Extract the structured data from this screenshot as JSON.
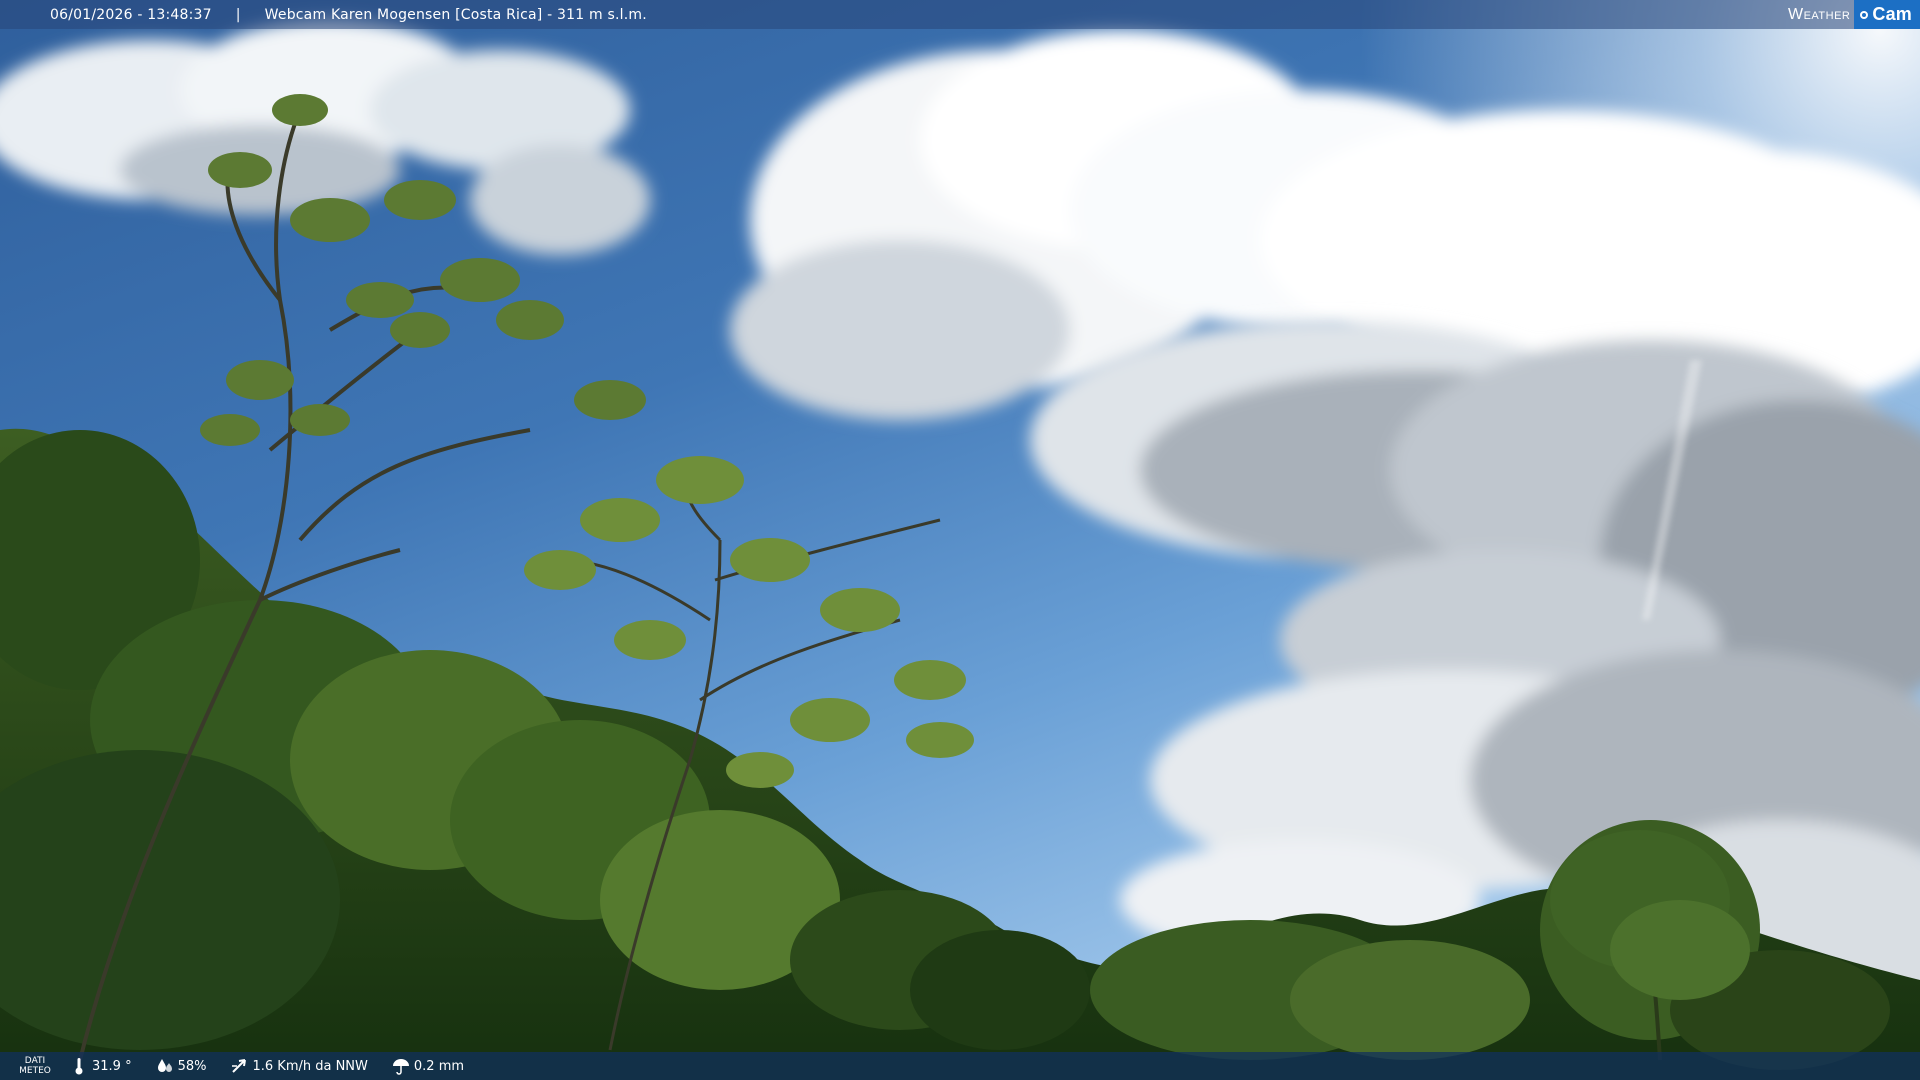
{
  "overlay": {
    "datetime": "06/01/2026 - 13:48:37",
    "separator": "|",
    "camera_title": "Webcam Karen Mogensen [Costa Rica] - 311 m s.l.m."
  },
  "logo": {
    "weather_text": "Weather",
    "cam_text": "Cam"
  },
  "meteo": {
    "label_line1": "DATI",
    "label_line2": "METEO",
    "temperature": "31.9 °",
    "humidity": "58%",
    "wind": "1.6 Km/h da NNW",
    "rain": "0.2 mm"
  },
  "colors": {
    "sky_top": "#2f5f9c",
    "sky_bottom": "#d6eaf9",
    "foliage_dark": "#1f3a18",
    "foliage_light": "#6f8f3a",
    "cam_badge": "#1c6fc4"
  }
}
